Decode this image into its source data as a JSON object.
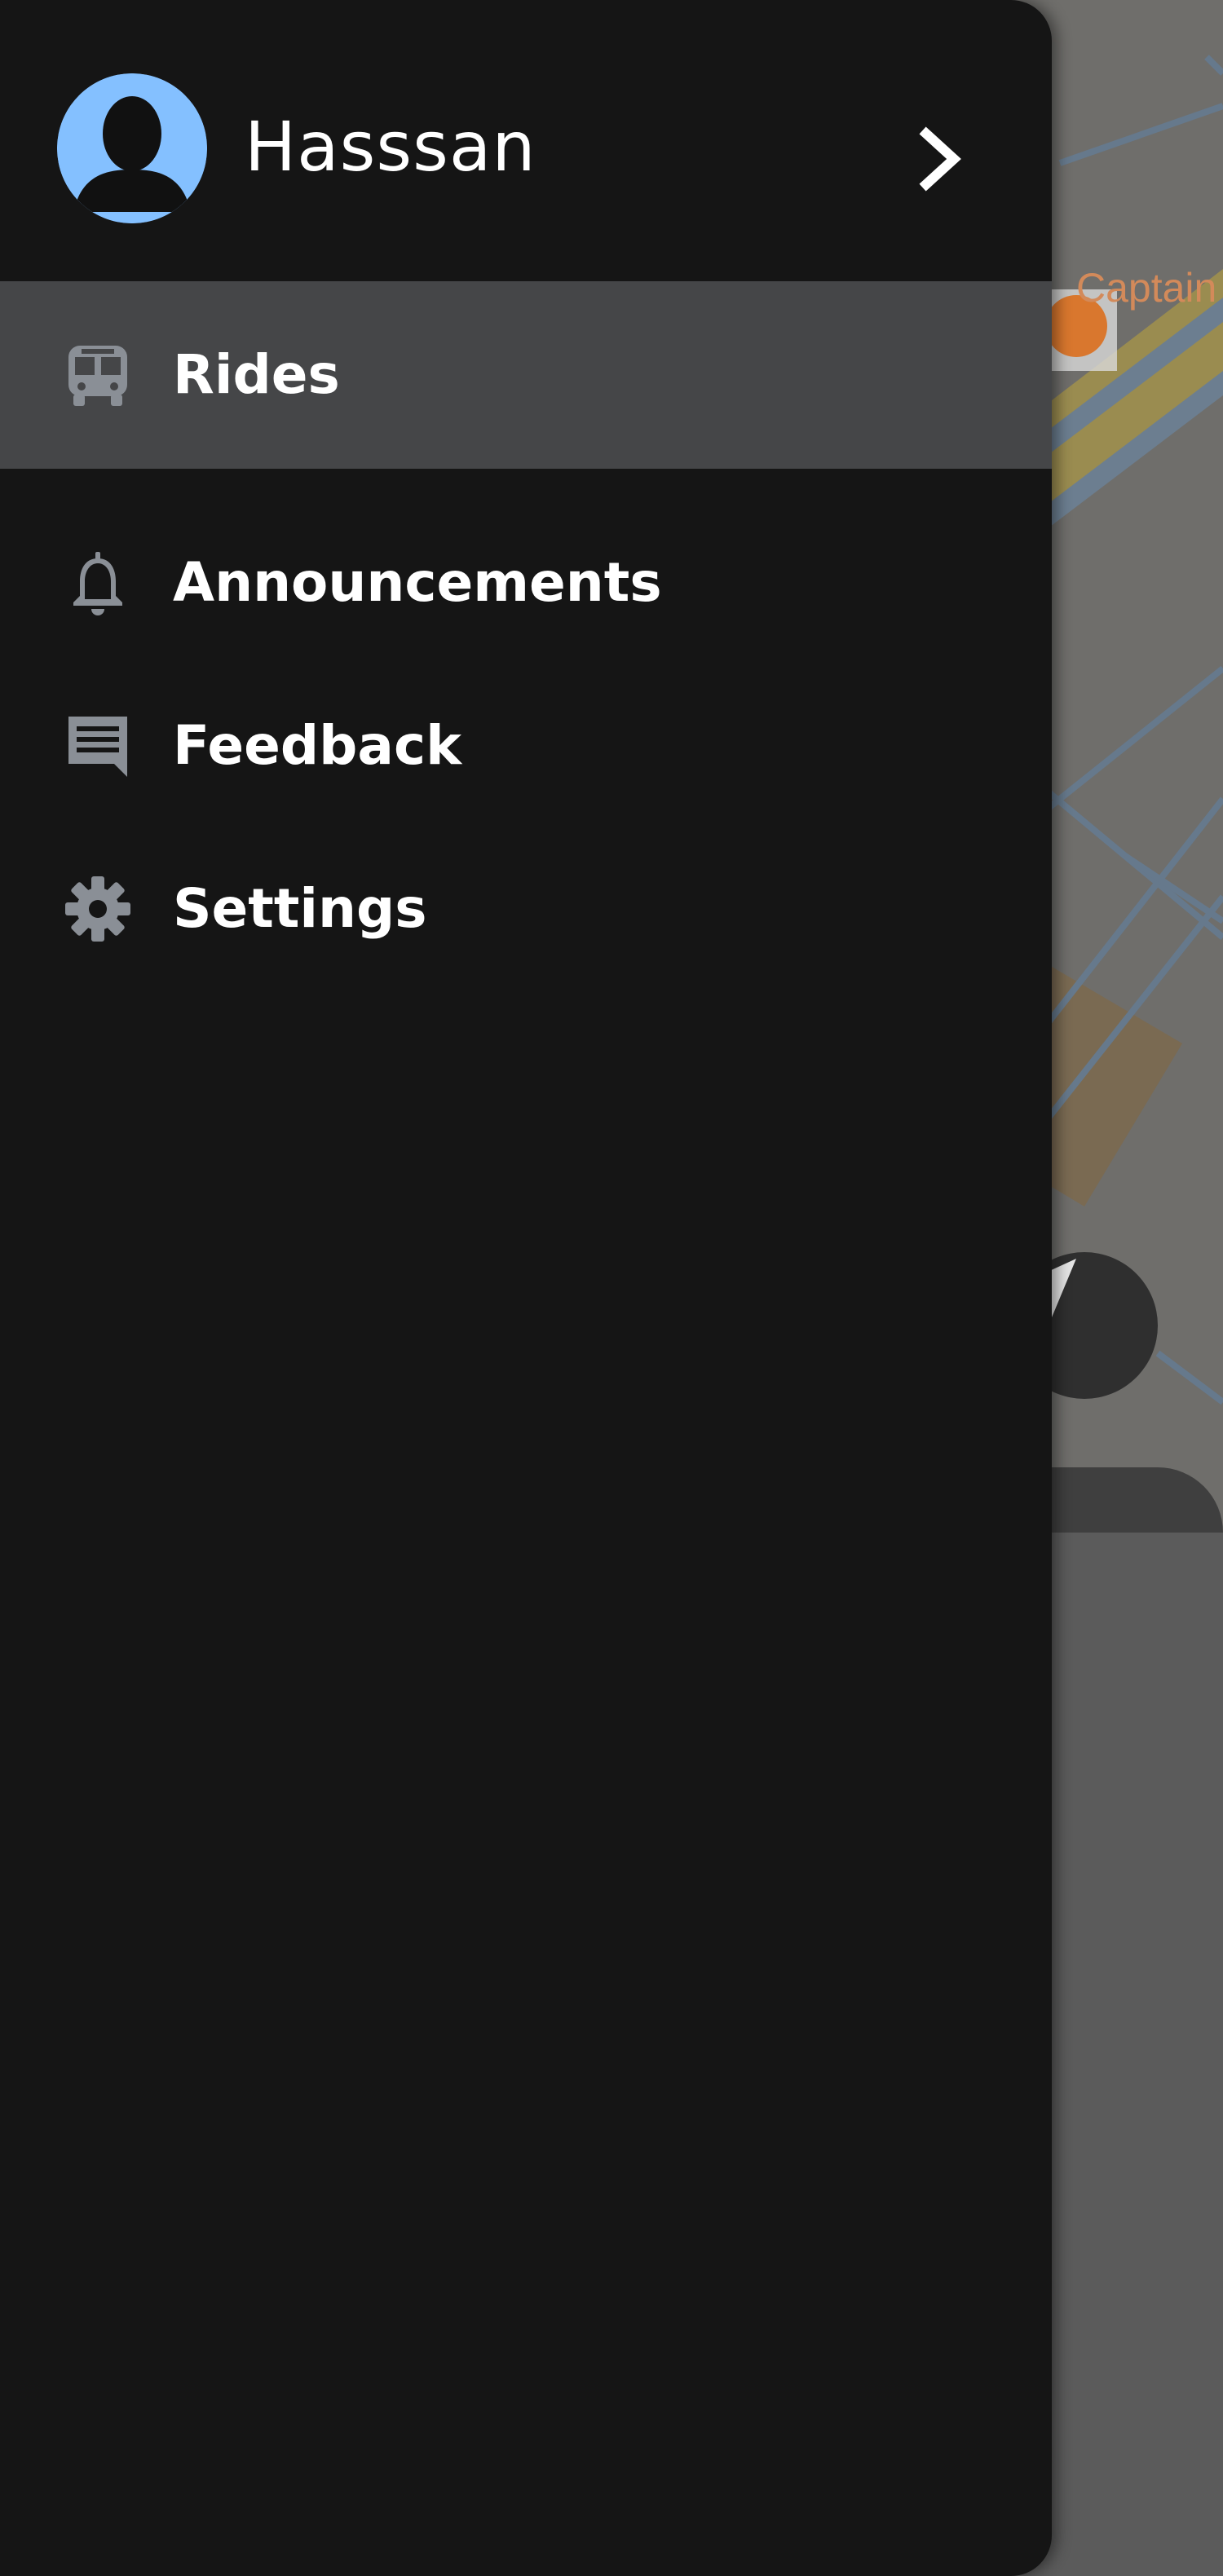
{
  "user": {
    "name": "Hasssan"
  },
  "nav": {
    "items": [
      {
        "label": "Rides",
        "icon": "bus-icon",
        "active": true
      },
      {
        "label": "Announcements",
        "icon": "bell-icon",
        "active": false
      },
      {
        "label": "Feedback",
        "icon": "feedback-icon",
        "active": false
      },
      {
        "label": "Settings",
        "icon": "gear-icon",
        "active": false
      }
    ]
  },
  "map": {
    "place_label": "Captain",
    "poi_icon": "restaurant-icon"
  },
  "colors": {
    "drawer_bg": "#151515",
    "active_item_bg": "#454648",
    "avatar_bg": "#84c0ff",
    "icon_gray": "#8a8f96",
    "primary_button": "#1273b0"
  }
}
